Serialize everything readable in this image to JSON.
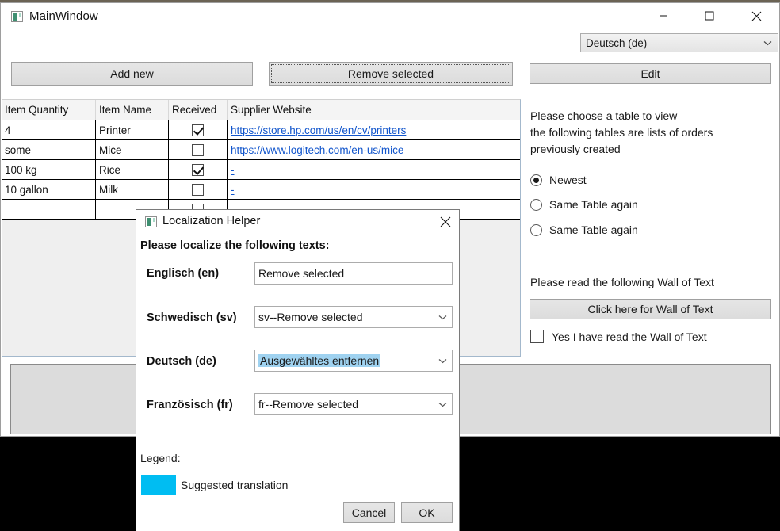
{
  "window": {
    "title": "MainWindow",
    "icon": "app-window-icon",
    "controls": {
      "minimize": "minimize-icon",
      "maximize": "maximize-icon",
      "close": "close-icon"
    }
  },
  "toolbar": {
    "language_combo": {
      "value": "Deutsch (de)",
      "arrow": "chevron-down-icon"
    },
    "add_new_label": "Add new",
    "remove_selected_label": "Remove selected",
    "edit_label": "Edit"
  },
  "table": {
    "columns": [
      "Item Quantity",
      "Item Name",
      "Received",
      "Supplier Website",
      ""
    ],
    "rows": [
      {
        "quantity": "4",
        "name": "Printer",
        "received": true,
        "website": "https://store.hp.com/us/en/cv/printers",
        "extra": ""
      },
      {
        "quantity": "some",
        "name": "Mice",
        "received": false,
        "website": "https://www.logitech.com/en-us/mice",
        "extra": ""
      },
      {
        "quantity": "100 kg",
        "name": "Rice",
        "received": true,
        "website": "-",
        "extra": ""
      },
      {
        "quantity": "10 gallon",
        "name": "Milk",
        "received": false,
        "website": "-",
        "extra": ""
      },
      {
        "quantity": "",
        "name": "",
        "received": false,
        "website": "",
        "extra": ""
      }
    ]
  },
  "right_panel": {
    "instructions_line1": "Please choose a table to view",
    "instructions_line2": "the following tables are lists of orders",
    "instructions_line3": "previously created",
    "radios": [
      {
        "label": "Newest",
        "selected": true
      },
      {
        "label": "Same Table again",
        "selected": false
      },
      {
        "label": "Same Table again",
        "selected": false
      }
    ],
    "wall_prompt": "Please read the following Wall of Text",
    "wall_button_label": "Click here for Wall of Text",
    "wall_checkbox_label": "Yes I have read the Wall of Text",
    "wall_checkbox_checked": false
  },
  "dialog": {
    "title": "Localization Helper",
    "icon": "app-window-icon",
    "close": "close-icon",
    "heading": "Please localize the following texts:",
    "fields": [
      {
        "label": "Englisch (en)",
        "value": "Remove selected",
        "type": "textbox",
        "highlighted": false
      },
      {
        "label": "Schwedisch (sv)",
        "value": "sv--Remove selected",
        "type": "combobox",
        "highlighted": false
      },
      {
        "label": "Deutsch (de)",
        "value": "Ausgewähltes entfernen",
        "type": "combobox",
        "highlighted": true
      },
      {
        "label": "Französisch (fr)",
        "value": "fr--Remove selected",
        "type": "combobox",
        "highlighted": false
      }
    ],
    "legend_title": "Legend:",
    "legend_swatch_color": "#00bdf2",
    "legend_label": "Suggested translation",
    "cancel_label": "Cancel",
    "ok_label": "OK"
  },
  "colors": {
    "link": "#1155cc",
    "suggested_highlight": "#9fd2f0",
    "legend_cyan": "#00bdf2",
    "button_face": "#dcdcdc",
    "panel_face": "#dcdcdc"
  }
}
